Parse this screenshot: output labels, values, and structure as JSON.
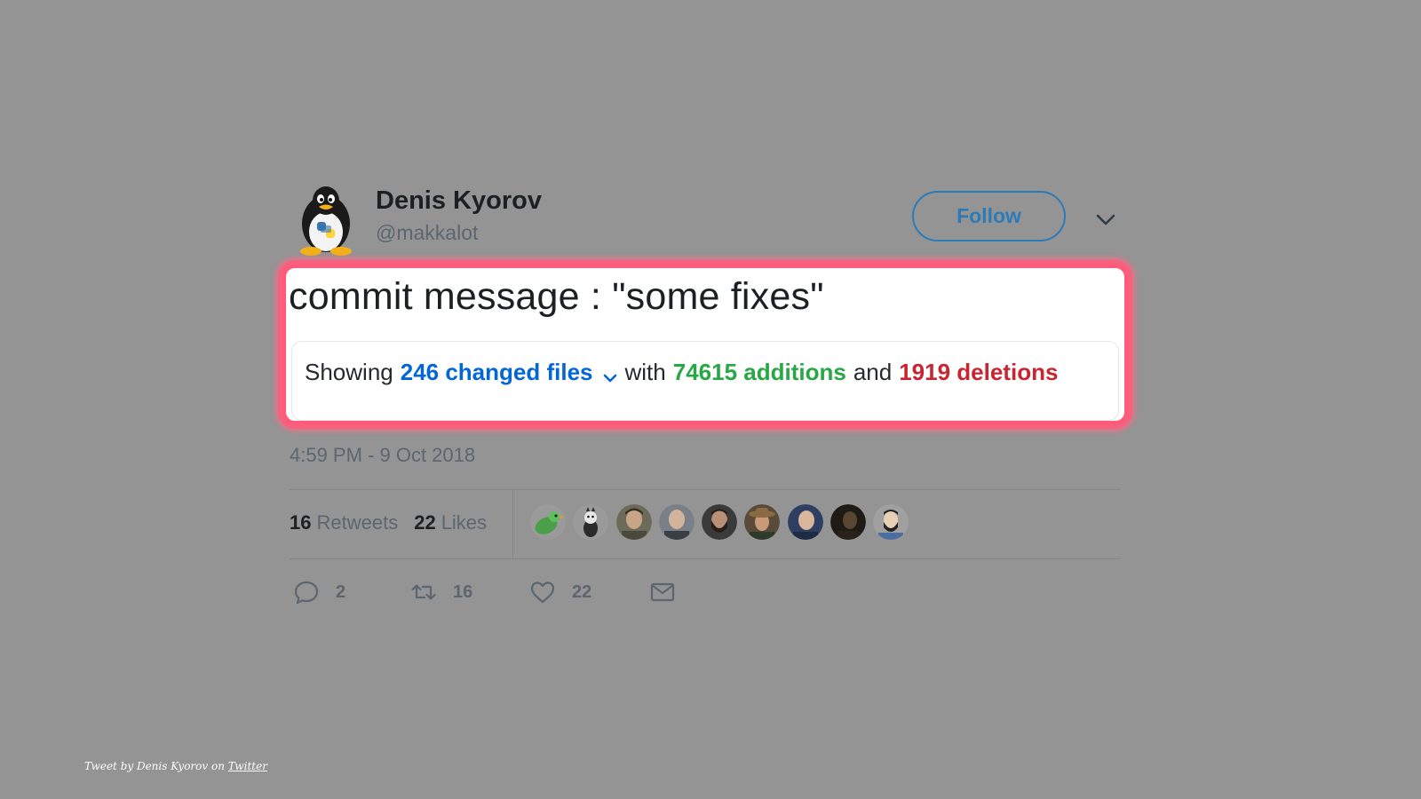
{
  "author": {
    "display_name": "Denis Kyorov",
    "handle": "@makkalot",
    "avatar_icon": "tux-python-penguin-avatar"
  },
  "follow_button": {
    "label": "Follow",
    "color": "#2b7bb9"
  },
  "more_menu_icon": "chevron-down-icon",
  "tweet": {
    "text": "commit message : \"some fixes\"",
    "highlight_color": "#ff5a7a"
  },
  "github_summary": {
    "showing_label": "Showing",
    "changed_files": "246 changed files",
    "with_label": "with",
    "additions": "74615 additions",
    "and_label": "and",
    "deletions": "1919 deletions",
    "colors": {
      "files": "#0366d6",
      "additions": "#28a745",
      "deletions": "#cb2431"
    }
  },
  "timestamp": "4:59 PM - 9 Oct 2018",
  "stats": {
    "retweets_count": "16",
    "retweets_label": "Retweets",
    "likes_count": "22",
    "likes_label": "Likes"
  },
  "likers": [
    "green-bird-avatar",
    "cartoon-character-avatar",
    "man-photo-avatar",
    "bald-man-avatar",
    "bearded-man-avatar",
    "man-with-hat-avatar",
    "man-portrait-avatar",
    "dark-photo-avatar",
    "cartoon-bearded-man-avatar"
  ],
  "actions": {
    "reply_count": "2",
    "retweet_count": "16",
    "like_count": "22"
  },
  "credit": {
    "prefix": "Tweet by Denis Kyorov on",
    "link_label": "Twitter"
  }
}
